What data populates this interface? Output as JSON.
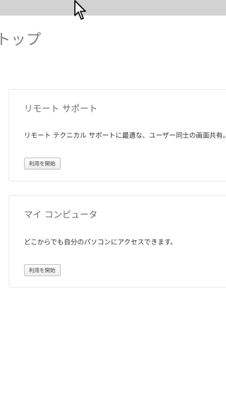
{
  "page": {
    "title": "トップ"
  },
  "cards": [
    {
      "title": "リモート サポート",
      "description": "リモート テクニカル サポートに最適な、ユーザー同士の画面共有。",
      "button_label": "利用を開始"
    },
    {
      "title": "マイ コンピュータ",
      "description": "どこからでも自分のパソコンにアクセスできます。",
      "button_label": "利用を開始"
    }
  ],
  "icons": {
    "cursor": "mouse-pointer-icon"
  },
  "colors": {
    "top_strip": "#d2d2d2",
    "title_text": "#7d7d7d",
    "card_border": "#ececec"
  }
}
